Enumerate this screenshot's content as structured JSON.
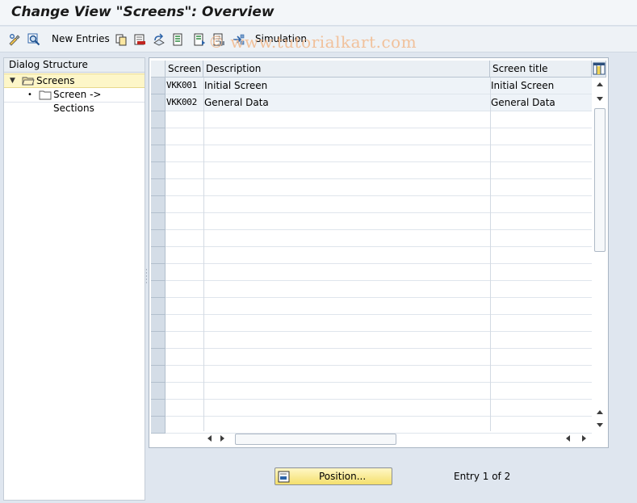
{
  "window": {
    "title": "Change View \"Screens\": Overview"
  },
  "toolbar": {
    "new_entries_label": "New Entries",
    "simulation_label": "Simulation",
    "watermark": "© www.tutorialkart.com"
  },
  "dialog_structure": {
    "heading": "Dialog Structure",
    "items": [
      {
        "label": "Screens",
        "selected": true
      },
      {
        "label": "Screen -> Sections",
        "selected": false
      }
    ]
  },
  "table": {
    "columns": [
      "Screen",
      "Description",
      "Screen title"
    ],
    "rows": [
      [
        "VKK001",
        "Initial Screen",
        "Initial Screen"
      ],
      [
        "VKK002",
        "General Data",
        "General Data"
      ]
    ],
    "visible_rows": 21
  },
  "footer": {
    "position_label": "Position...",
    "entry_text": "Entry 1 of 2"
  },
  "colors": {
    "selected_row": "#fdf6c8",
    "header_bg": "#eaeff4",
    "button_yellow": "#f4df6c",
    "watermark": "#f2b98c"
  }
}
